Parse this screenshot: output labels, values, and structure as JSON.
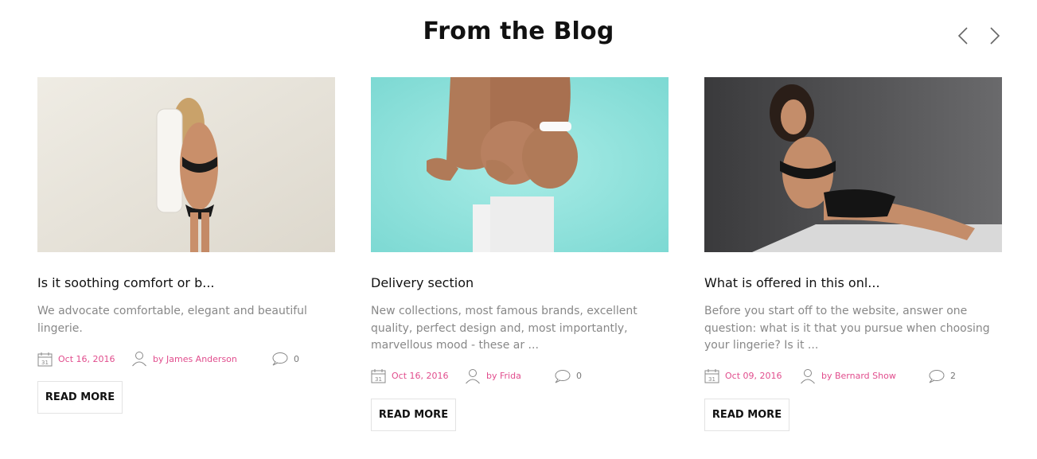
{
  "section": {
    "title": "From the Blog"
  },
  "nav": {
    "prev_icon": "chevron-left-icon",
    "next_icon": "chevron-right-icon"
  },
  "colors": {
    "accent": "#e14d8d",
    "meta_gray": "#777777",
    "excerpt_gray": "#888888"
  },
  "posts": [
    {
      "title": "Is it soothing comfort or b...",
      "excerpt": "We advocate comfortable, elegant and beautiful lingerie.",
      "date": "Oct 16, 2016",
      "author": "by James Anderson",
      "comments": "0",
      "read_more": "READ MORE",
      "image_icon": "blog-photo-model-white-background"
    },
    {
      "title": "Delivery section",
      "excerpt": "New collections, most famous brands, excellent quality, perfect design and, most importantly, marvellous mood - these ar ...",
      "date": "Oct 16, 2016",
      "author": "by Frida",
      "comments": "0",
      "read_more": "READ MORE",
      "image_icon": "blog-photo-model-turquoise-background"
    },
    {
      "title": "What is offered in this onl...",
      "excerpt": "Before you start off to the website, answer one question: what is it that you pursue when choosing your lingerie? Is it ...",
      "date": "Oct 09, 2016",
      "author": "by Bernard Show",
      "comments": "2",
      "read_more": "READ MORE",
      "image_icon": "blog-photo-model-dark-background"
    }
  ]
}
